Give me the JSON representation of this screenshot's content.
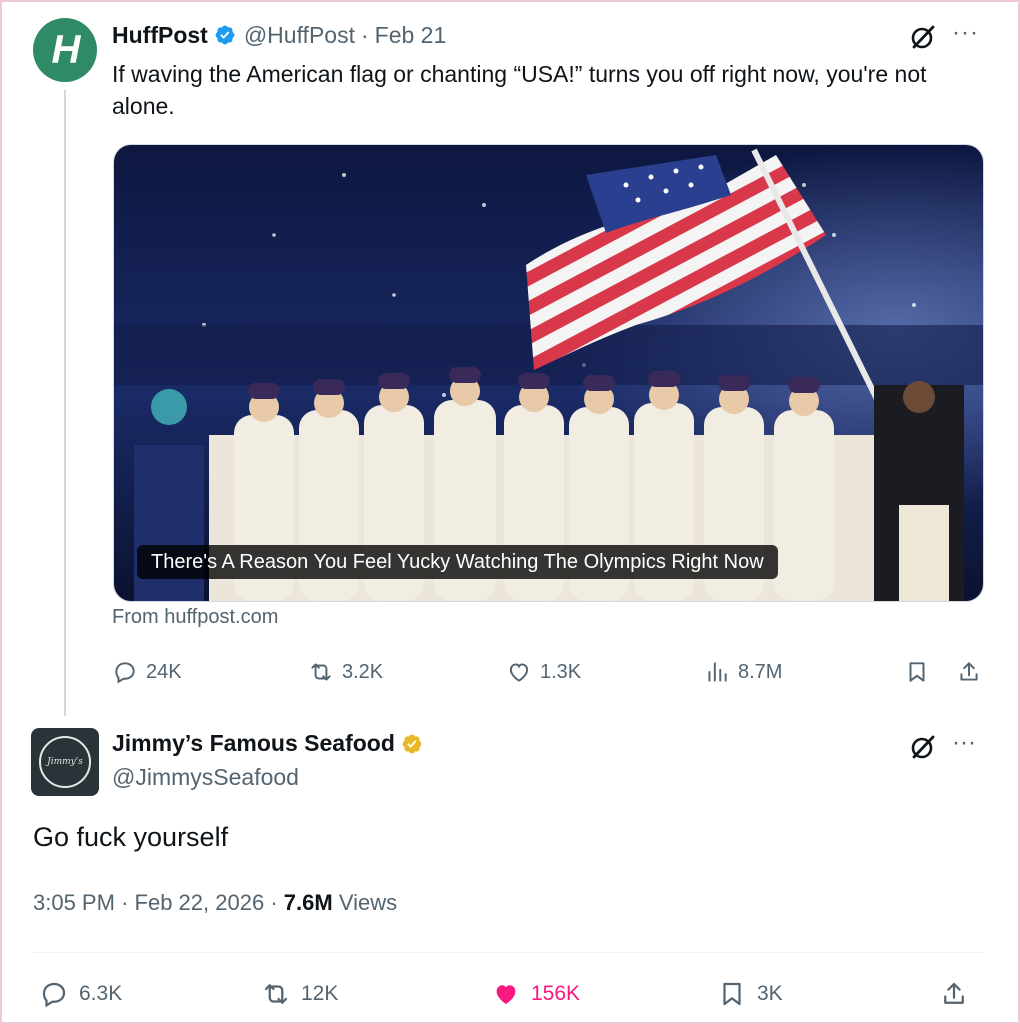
{
  "tweet1": {
    "author_name": "HuffPost",
    "author_handle": "@HuffPost",
    "separator": "·",
    "date": "Feb 21",
    "avatar_letter": "H",
    "text": "If waving the American flag or chanting “USA!” turns you off right now, you're not alone.",
    "card_caption": "There's A Reason You Feel Yucky Watching The Olympics Right Now",
    "card_source": "From huffpost.com",
    "more": "···",
    "stats": {
      "replies": "24K",
      "reposts": "3.2K",
      "likes": "1.3K",
      "views": "8.7M"
    },
    "brand_color": "#2e8b66",
    "verified_color": "#1d9bf0"
  },
  "tweet2": {
    "author_name": "Jimmy’s Famous Seafood",
    "author_handle": "@JimmysSeafood",
    "text": "Go fuck yourself",
    "time": "3:05 PM",
    "separator": "·",
    "date": "Feb 22, 2026",
    "views_count": "7.6M",
    "views_label": "Views",
    "more": "···",
    "stats": {
      "replies": "6.3K",
      "reposts": "12K",
      "likes": "156K",
      "bookmarks": "3K"
    },
    "verified_color": "#e8b828",
    "like_color": "#f91880"
  },
  "icons": [
    "verified-badge-icon",
    "grok-icon",
    "more-icon",
    "reply-icon",
    "repost-icon",
    "like-icon",
    "views-icon",
    "bookmark-icon",
    "share-icon"
  ]
}
